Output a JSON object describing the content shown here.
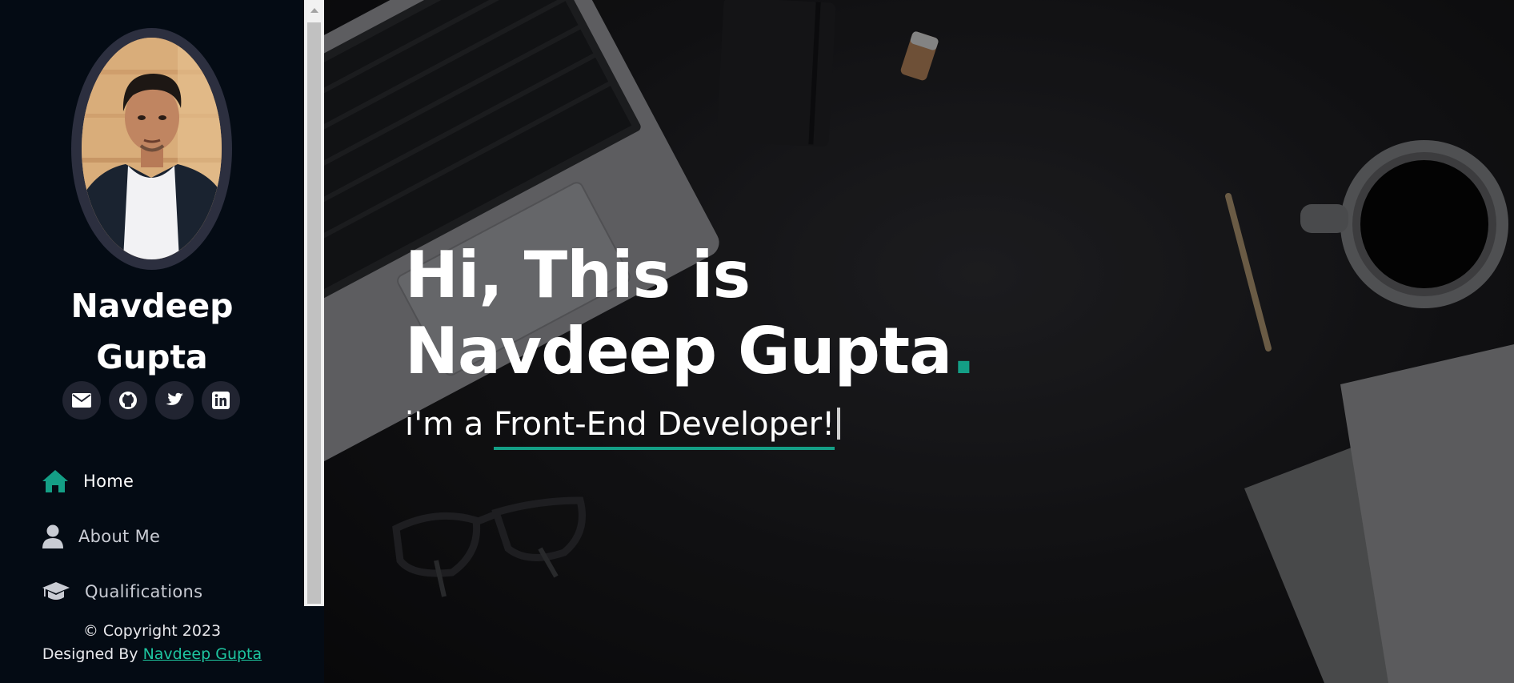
{
  "profile": {
    "name_line1": "Navdeep",
    "name_line2": "Gupta"
  },
  "social": [
    {
      "name": "email",
      "icon": "envelope-icon"
    },
    {
      "name": "github",
      "icon": "github-icon"
    },
    {
      "name": "twitter",
      "icon": "twitter-icon"
    },
    {
      "name": "linkedin",
      "icon": "linkedin-icon"
    }
  ],
  "nav": {
    "items": [
      {
        "label": "Home",
        "icon": "home-icon",
        "active": true
      },
      {
        "label": "About Me",
        "icon": "user-icon",
        "active": false
      },
      {
        "label": "Qualifications",
        "icon": "graduation-cap-icon",
        "active": false
      }
    ]
  },
  "footer": {
    "copyright": "© Copyright 2023",
    "designed_by_prefix": "Designed By ",
    "designer_link": "Navdeep Gupta"
  },
  "hero": {
    "title_line1": "Hi, This is",
    "title_line2": "Navdeep Gupta",
    "title_dot": ".",
    "subtitle_prefix": "i'm a ",
    "subtitle_typed": "Front-End Developer!"
  },
  "colors": {
    "accent": "#149f86",
    "sidebar_bg": "#040b14",
    "social_bg": "#212431"
  }
}
